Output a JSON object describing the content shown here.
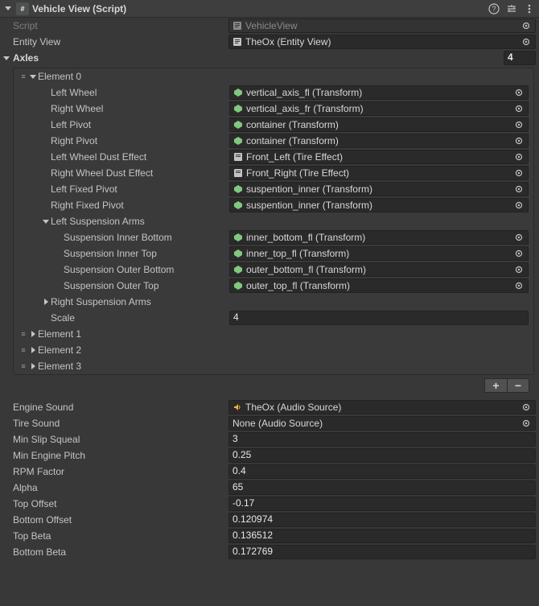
{
  "header": {
    "title": "Vehicle View (Script)"
  },
  "script_row": {
    "label": "Script",
    "value": "VehicleView"
  },
  "entity_view_row": {
    "label": "Entity View",
    "value": "TheOx (Entity View)"
  },
  "axles": {
    "label": "Axles",
    "count": "4",
    "element0": {
      "label": "Element 0",
      "left_wheel": {
        "label": "Left Wheel",
        "value": "vertical_axis_fl (Transform)"
      },
      "right_wheel": {
        "label": "Right Wheel",
        "value": "vertical_axis_fr (Transform)"
      },
      "left_pivot": {
        "label": "Left Pivot",
        "value": "container (Transform)"
      },
      "right_pivot": {
        "label": "Right Pivot",
        "value": "container (Transform)"
      },
      "left_dust": {
        "label": "Left Wheel Dust Effect",
        "value": "Front_Left (Tire Effect)"
      },
      "right_dust": {
        "label": "Right Wheel Dust Effect",
        "value": "Front_Right (Tire Effect)"
      },
      "left_fixed": {
        "label": "Left Fixed Pivot",
        "value": "suspention_inner (Transform)"
      },
      "right_fixed": {
        "label": "Right Fixed Pivot",
        "value": "suspention_inner (Transform)"
      },
      "left_susp": {
        "label": "Left Suspension Arms",
        "inner_bottom": {
          "label": "Suspension Inner Bottom",
          "value": "inner_bottom_fl (Transform)"
        },
        "inner_top": {
          "label": "Suspension Inner Top",
          "value": "inner_top_fl (Transform)"
        },
        "outer_bottom": {
          "label": "Suspension Outer Bottom",
          "value": "outer_bottom_fl (Transform)"
        },
        "outer_top": {
          "label": "Suspension Outer Top",
          "value": "outer_top_fl (Transform)"
        }
      },
      "right_susp": {
        "label": "Right Suspension Arms"
      },
      "scale": {
        "label": "Scale",
        "value": "4"
      }
    },
    "elements": [
      {
        "label": "Element 1"
      },
      {
        "label": "Element 2"
      },
      {
        "label": "Element 3"
      }
    ]
  },
  "props": {
    "engine_sound": {
      "label": "Engine Sound",
      "value": "TheOx (Audio Source)"
    },
    "tire_sound": {
      "label": "Tire Sound",
      "value": "None (Audio Source)"
    },
    "min_slip": {
      "label": "Min Slip Squeal",
      "value": "3"
    },
    "min_pitch": {
      "label": "Min Engine Pitch",
      "value": "0.25"
    },
    "rpm": {
      "label": "RPM Factor",
      "value": "0.4"
    },
    "alpha": {
      "label": "Alpha",
      "value": "65"
    },
    "top_offset": {
      "label": "Top Offset",
      "value": "-0.17"
    },
    "bottom_offset": {
      "label": "Bottom Offset",
      "value": "0.120974"
    },
    "top_beta": {
      "label": "Top Beta",
      "value": "0.136512"
    },
    "bottom_beta": {
      "label": "Bottom Beta",
      "value": "0.172769"
    }
  },
  "icons": {
    "transform_color": "#7fc97f",
    "prefab_color": "#b0b0b0",
    "audio_color": "#f5b042"
  }
}
